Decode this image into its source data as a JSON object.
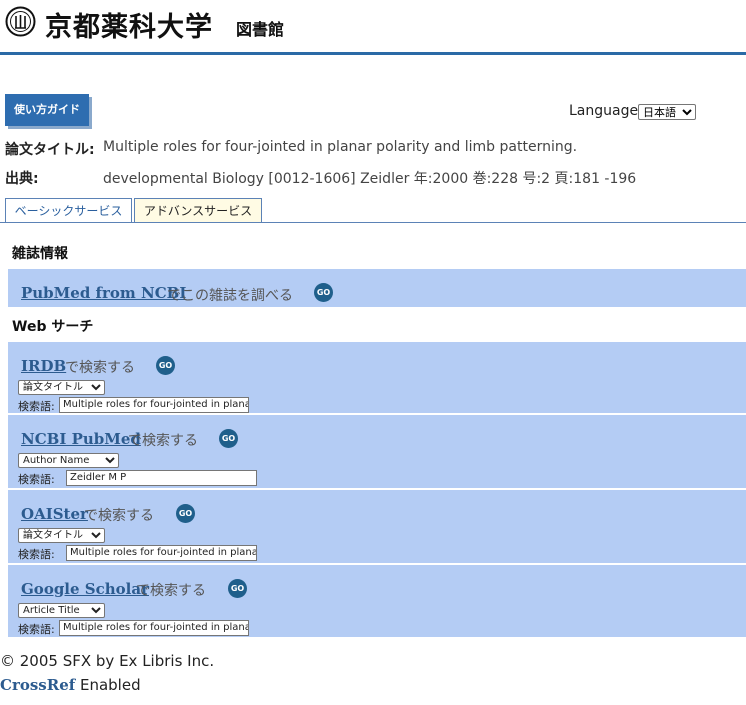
{
  "header": {
    "logo_text": "京都薬科大学",
    "logo_sub": "図書館",
    "seal_icon": "university-seal-icon"
  },
  "toolbar": {
    "guide_label": "使い方ガイド",
    "language_label": "Language",
    "language_selected": "日本語"
  },
  "citation": {
    "title_label": "論文タイトル:",
    "title_value": "Multiple roles for four-jointed in planar polarity and limb patterning.",
    "source_label": "出典:",
    "source_value": "developmental Biology [0012-1606] Zeidler 年:2000 巻:228 号:2 頁:181 -196"
  },
  "tabs": [
    {
      "label": "ベーシックサービス"
    },
    {
      "label": "アドバンスサービス"
    }
  ],
  "journal_section": {
    "title": "雑誌情報",
    "link": "PubMed from NCBI",
    "suffix": "でこの雑誌を調べる",
    "go": "GO"
  },
  "web_section": {
    "title": "Web サーチ",
    "items": [
      {
        "link": "IRDB",
        "suffix": "で検索する",
        "go": "GO",
        "select": "論文タイトル",
        "kw_label": "検索語:",
        "kw_value": "Multiple roles for four-jointed in planar polarity and limb patterning."
      },
      {
        "link": "NCBI PubMed",
        "suffix": "で検索する",
        "go": "GO",
        "select": "Author Name",
        "kw_label": "検索語:",
        "kw_value": "Zeidler M P"
      },
      {
        "link": "OAISter",
        "suffix": "で検索する",
        "go": "GO",
        "select": "論文タイトル",
        "kw_label": "検索語:",
        "kw_value": "Multiple roles for four-jointed in planar polarity and limb patterning."
      },
      {
        "link": "Google Scholar",
        "suffix": "で検索する",
        "go": "GO",
        "select": "Article Title",
        "kw_label": "検索語:",
        "kw_value": "Multiple roles for four-jointed in planar polarity and limb patterning."
      }
    ]
  },
  "footer": {
    "copyright": "© 2005 SFX by Ex Libris Inc.",
    "crossref_link": "CrossRef",
    "crossref_suffix": "Enabled"
  },
  "colors": {
    "accent": "#2a6aa6",
    "panel": "#b4ccf4",
    "link": "#2c5b8f",
    "go_button": "#1f5f8b",
    "active_tab": "#fffbe4"
  }
}
